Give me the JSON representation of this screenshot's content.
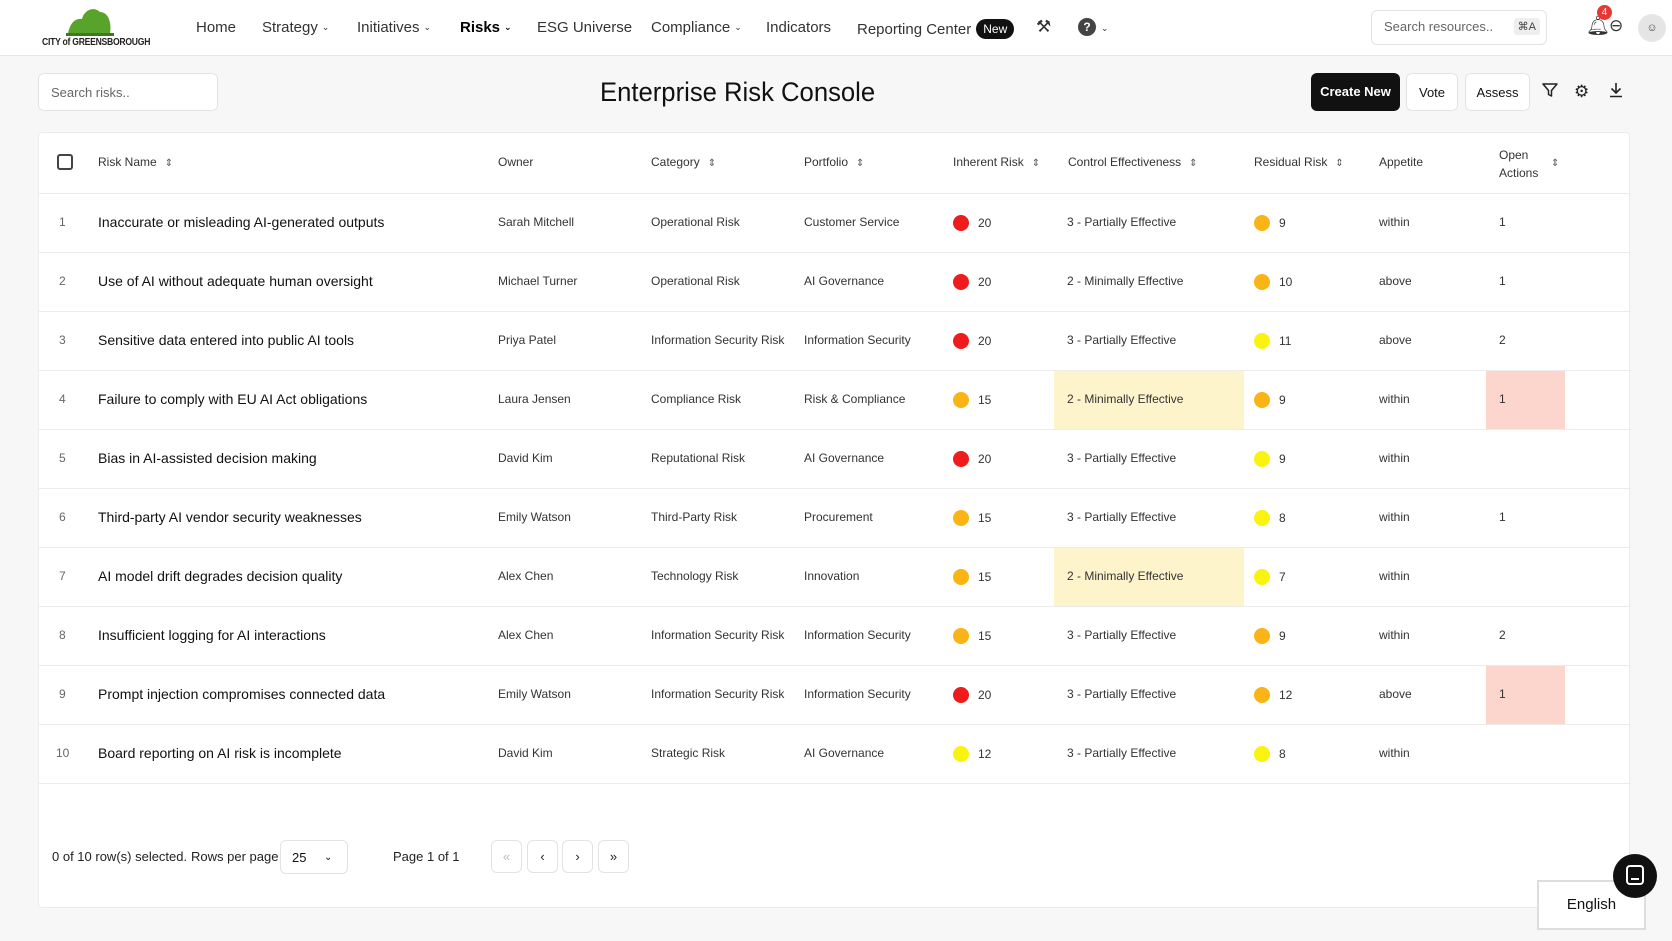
{
  "logo": {
    "text": "CITY of GREENSBOROUGH"
  },
  "nav": {
    "home": "Home",
    "strategy": "Strategy",
    "initiatives": "Initiatives",
    "risks": "Risks",
    "esg": "ESG Universe",
    "compliance": "Compliance",
    "indicators": "Indicators",
    "reporting": "Reporting Center",
    "new_badge": "New"
  },
  "top_search": {
    "placeholder": "Search resources..",
    "shortcut": "⌘A"
  },
  "notifications": {
    "count": "4"
  },
  "toolbar": {
    "search_placeholder": "Search risks..",
    "title": "Enterprise Risk Console",
    "create_label": "Create New",
    "vote_label": "Vote",
    "assess_label": "Assess"
  },
  "columns": {
    "name": "Risk Name",
    "owner": "Owner",
    "category": "Category",
    "portfolio": "Portfolio",
    "inherent": "Inherent Risk",
    "control": "Control Effectiveness",
    "residual": "Residual Risk",
    "appetite": "Appetite",
    "open_actions_1": "Open",
    "open_actions_2": "Actions"
  },
  "colors": {
    "red": "#ee1c1c",
    "orange": "#fbb415",
    "yellow": "#faf20f",
    "highlight_yellow": "#fdf4cc",
    "highlight_red": "#fcd5cc"
  },
  "rows": [
    {
      "idx": "1",
      "name": "Inaccurate or misleading AI-generated outputs",
      "owner": "Sarah Mitchell",
      "category": "Operational Risk",
      "portfolio": "Customer Service",
      "inherent": "20",
      "inherent_color": "red",
      "control": "3 - Partially Effective",
      "control_highlight": false,
      "residual": "9",
      "residual_color": "orange",
      "appetite": "within",
      "actions": "1",
      "actions_highlight": false
    },
    {
      "idx": "2",
      "name": "Use of AI without adequate human oversight",
      "owner": "Michael Turner",
      "category": "Operational Risk",
      "portfolio": "AI Governance",
      "inherent": "20",
      "inherent_color": "red",
      "control": "2 - Minimally Effective",
      "control_highlight": false,
      "residual": "10",
      "residual_color": "orange",
      "appetite": "above",
      "actions": "1",
      "actions_highlight": false
    },
    {
      "idx": "3",
      "name": "Sensitive data entered into public AI tools",
      "owner": "Priya Patel",
      "category": "Information Security Risk",
      "portfolio": "Information Security",
      "inherent": "20",
      "inherent_color": "red",
      "control": "3 - Partially Effective",
      "control_highlight": false,
      "residual": "11",
      "residual_color": "yellow",
      "appetite": "above",
      "actions": "2",
      "actions_highlight": false
    },
    {
      "idx": "4",
      "name": "Failure to comply with EU AI Act obligations",
      "owner": "Laura Jensen",
      "category": "Compliance Risk",
      "portfolio": "Risk & Compliance",
      "inherent": "15",
      "inherent_color": "orange",
      "control": "2 - Minimally Effective",
      "control_highlight": true,
      "residual": "9",
      "residual_color": "orange",
      "appetite": "within",
      "actions": "1",
      "actions_highlight": true
    },
    {
      "idx": "5",
      "name": "Bias in AI-assisted decision making",
      "owner": "David Kim",
      "category": "Reputational Risk",
      "portfolio": "AI Governance",
      "inherent": "20",
      "inherent_color": "red",
      "control": "3 - Partially Effective",
      "control_highlight": false,
      "residual": "9",
      "residual_color": "yellow",
      "appetite": "within",
      "actions": "",
      "actions_highlight": false
    },
    {
      "idx": "6",
      "name": "Third-party AI vendor security weaknesses",
      "owner": "Emily Watson",
      "category": "Third-Party Risk",
      "portfolio": "Procurement",
      "inherent": "15",
      "inherent_color": "orange",
      "control": "3 - Partially Effective",
      "control_highlight": false,
      "residual": "8",
      "residual_color": "yellow",
      "appetite": "within",
      "actions": "1",
      "actions_highlight": false
    },
    {
      "idx": "7",
      "name": "AI model drift degrades decision quality",
      "owner": "Alex Chen",
      "category": "Technology Risk",
      "portfolio": "Innovation",
      "inherent": "15",
      "inherent_color": "orange",
      "control": "2 - Minimally Effective",
      "control_highlight": true,
      "residual": "7",
      "residual_color": "yellow",
      "appetite": "within",
      "actions": "",
      "actions_highlight": false
    },
    {
      "idx": "8",
      "name": "Insufficient logging for AI interactions",
      "owner": "Alex Chen",
      "category": "Information Security Risk",
      "portfolio": "Information Security",
      "inherent": "15",
      "inherent_color": "orange",
      "control": "3 - Partially Effective",
      "control_highlight": false,
      "residual": "9",
      "residual_color": "orange",
      "appetite": "within",
      "actions": "2",
      "actions_highlight": false
    },
    {
      "idx": "9",
      "name": "Prompt injection compromises connected data",
      "owner": "Emily Watson",
      "category": "Information Security Risk",
      "portfolio": "Information Security",
      "inherent": "20",
      "inherent_color": "red",
      "control": "3 - Partially Effective",
      "control_highlight": false,
      "residual": "12",
      "residual_color": "orange",
      "appetite": "above",
      "actions": "1",
      "actions_highlight": true
    },
    {
      "idx": "10",
      "name": "Board reporting on AI risk is incomplete",
      "owner": "David Kim",
      "category": "Strategic Risk",
      "portfolio": "AI Governance",
      "inherent": "12",
      "inherent_color": "yellow",
      "control": "3 - Partially Effective",
      "control_highlight": false,
      "residual": "8",
      "residual_color": "yellow",
      "appetite": "within",
      "actions": "",
      "actions_highlight": false
    }
  ],
  "footer": {
    "selected": "0 of 10 row(s) selected.",
    "rows_per_page_label": "Rows per page",
    "rows_per_page": "25",
    "page": "Page 1 of 1"
  },
  "language": "English"
}
